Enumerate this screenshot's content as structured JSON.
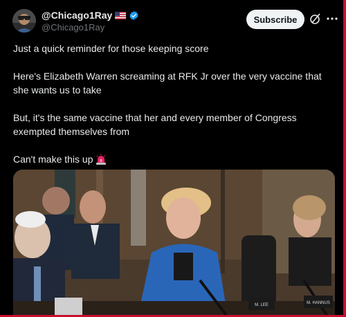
{
  "author": {
    "display_name": "@Chicago1Ray",
    "handle": "@Chicago1Ray",
    "flag_icon": "us-flag-icon",
    "verified_icon": "verified-badge-icon",
    "verified_color": "#1d9bf0"
  },
  "actions": {
    "subscribe_label": "Subscribe",
    "grok_icon": "grok-icon",
    "more_icon": "more-dots-icon"
  },
  "tweet": {
    "paragraphs": [
      "Just a quick reminder for those keeping score",
      "Here's Elizabeth Warren screaming at RFK Jr over the very vaccine that she wants us to take",
      "But, it's the same vaccine that her and every member of Congress exempted themselves from",
      "Can't make this up"
    ],
    "trailing_emoji_icon": "police-light-icon"
  },
  "media": {
    "type": "video",
    "nameplates": [
      "M. LEE",
      "M. HANNUS"
    ]
  },
  "colors": {
    "background": "#000000",
    "text": "#e7e9ea",
    "secondary_text": "#71767b",
    "button_bg": "#eff3f4",
    "frame_accent": "#c8102e"
  }
}
